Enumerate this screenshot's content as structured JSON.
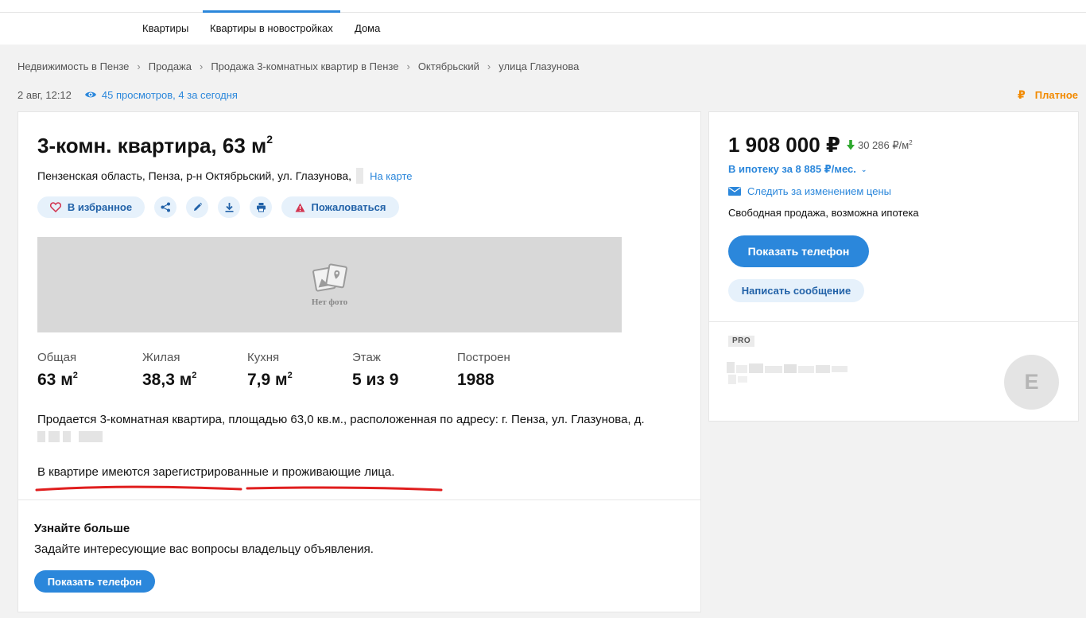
{
  "nav": {
    "items": [
      {
        "label": "Квартиры",
        "active": false
      },
      {
        "label": "Квартиры в новостройках",
        "active": true
      },
      {
        "label": "Дома",
        "active": false
      }
    ]
  },
  "breadcrumb": [
    "Недвижимость в Пензе",
    "Продажа",
    "Продажа 3-комнатных квартир в Пензе",
    "Октябрьский",
    "улица Глазунова"
  ],
  "meta": {
    "date": "2 авг, 12:12",
    "views": "45 просмотров, 4 за сегодня",
    "views_icon": "eye-icon",
    "paid_label": "Платное",
    "paid_icon": "₽"
  },
  "listing": {
    "title": "3-комн. квартира, 63 м",
    "title_sup": "2",
    "address": "Пензенская область, Пенза, р-н Октябрьский, ул. Глазунова,",
    "map_link": "На карте",
    "actions": {
      "favorite": "В избранное",
      "report": "Пожаловаться"
    },
    "no_photo": "Нет фото",
    "stats": [
      {
        "label": "Общая",
        "value": "63 м",
        "sup": "2"
      },
      {
        "label": "Жилая",
        "value": "38,3 м",
        "sup": "2"
      },
      {
        "label": "Кухня",
        "value": "7,9 м",
        "sup": "2"
      },
      {
        "label": "Этаж",
        "value": "5 из 9",
        "sup": ""
      },
      {
        "label": "Построен",
        "value": "1988",
        "sup": ""
      }
    ],
    "description_line1": "Продается 3-комнатная квартира, площадью 63,0 кв.м., расположенная по адресу: г. Пенза, ул. Глазунова, д.",
    "description_line2": "В квартире имеются зарегистрированные и проживающие лица.",
    "more": {
      "title": "Узнайте больше",
      "text": "Задайте интересующие вас вопросы владельцу объявления.",
      "button": "Показать телефон"
    }
  },
  "sidebar": {
    "price": "1 908 000 ₽",
    "price_trend": "down",
    "price_per_m2": "30 286 ₽/м",
    "price_per_m2_sup": "2",
    "mortgage": "В ипотеку за 8 885 ₽/мес.",
    "follow_price": "Следить за изменением цены",
    "sale_type": "Свободная продажа, возможна ипотека",
    "show_phone": "Показать телефон",
    "write_message": "Написать сообщение",
    "pro_badge": "PRO",
    "avatar_letter": "E"
  },
  "colors": {
    "accent": "#2b87db",
    "paid": "#f28a00",
    "annotation": "#e01e1e",
    "trend_down": "#2ea82e"
  }
}
